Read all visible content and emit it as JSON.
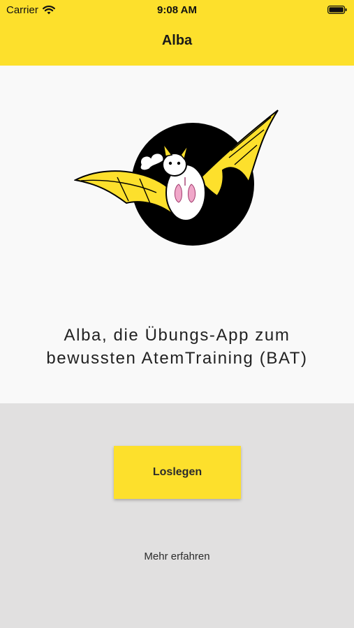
{
  "status_bar": {
    "carrier": "Carrier",
    "time": "9:08 AM",
    "icons": [
      "wifi-icon",
      "battery-icon"
    ]
  },
  "header": {
    "title": "Alba",
    "background": "#fde02c"
  },
  "hero": {
    "logo_icon": "bat-logo-icon",
    "tagline_line1": "Alba, die Übungs-App zum",
    "tagline_line2": "bewussten AtemTraining (BAT)"
  },
  "actions": {
    "start_label": "Loslegen",
    "more_label": "Mehr erfahren"
  },
  "colors": {
    "accent": "#fde02c",
    "hero_bg": "#f9f9f9",
    "bottom_bg": "#e1e0e0"
  }
}
